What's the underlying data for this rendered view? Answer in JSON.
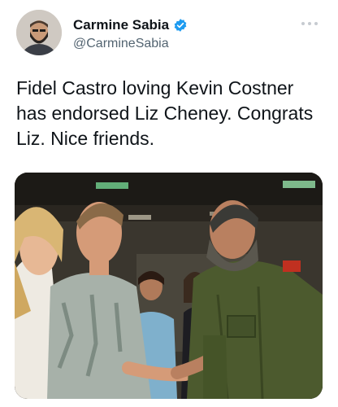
{
  "tweet": {
    "author": {
      "display_name": "Carmine Sabia",
      "handle": "@CarmineSabia",
      "verified": true,
      "avatar_icon": "profile-photo-avatar"
    },
    "more_icon": "more-options-icon",
    "text": "Fidel Castro loving Kevin Costner\nhas endorsed Liz Cheney. Congrats\nLiz. Nice friends.",
    "media": {
      "type": "photo",
      "icon": "photo-handshake"
    }
  },
  "colors": {
    "text_primary": "#0f1419",
    "text_secondary": "#536471",
    "verified_blue": "#1d9bf0",
    "background": "#ffffff"
  }
}
